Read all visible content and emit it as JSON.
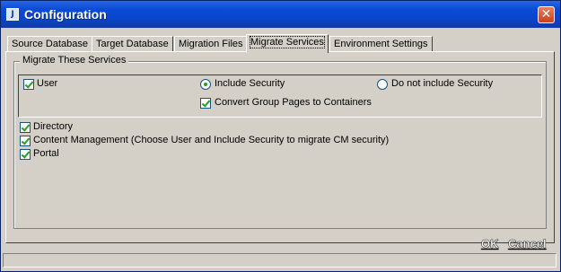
{
  "window": {
    "title": "Configuration",
    "app_icon": "app-icon",
    "close_icon": "close-icon"
  },
  "tabs": [
    {
      "label": "Source Database",
      "active": false
    },
    {
      "label": "Target Database",
      "active": false
    },
    {
      "label": "Migration Files",
      "active": false
    },
    {
      "label": "Migrate Services",
      "active": true
    },
    {
      "label": "Environment Settings",
      "active": false
    }
  ],
  "group": {
    "legend": "Migrate These Services",
    "user": {
      "label": "User",
      "checked": true
    },
    "include_security": {
      "label": "Include Security",
      "selected": true
    },
    "no_security": {
      "label": "Do not include Security",
      "selected": false
    },
    "convert_groups": {
      "label": "Convert Group Pages to Containers",
      "checked": true
    },
    "directory": {
      "label": "Directory",
      "checked": true
    },
    "content_management": {
      "label": "Content Management (Choose User and Include Security to migrate CM security)",
      "checked": true
    },
    "portal": {
      "label": "Portal",
      "checked": true
    }
  },
  "footer": {
    "ok_label": "OK",
    "cancel_label": "Cancel"
  },
  "colors": {
    "titlebar": "#0b4bd8",
    "check": "#21a121",
    "face": "#d4d0c8"
  }
}
